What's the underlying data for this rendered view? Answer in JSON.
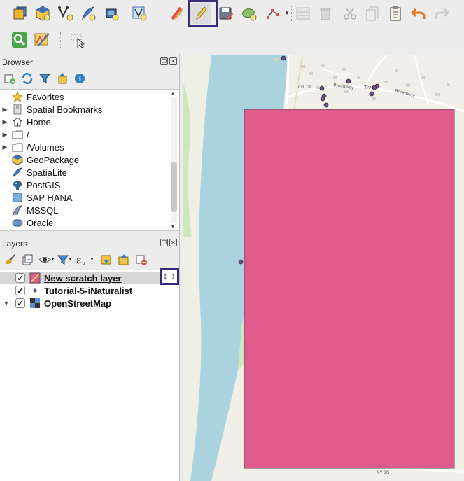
{
  "toolbar": {
    "top_buttons": [
      {
        "name": "open-data-source-manager",
        "icon": "data-source-manager-icon"
      },
      {
        "name": "new-geopackage-layer",
        "icon": "new-geopackage-icon"
      },
      {
        "name": "new-shapefile-layer",
        "icon": "new-shapefile-icon"
      },
      {
        "name": "new-spatialite-layer",
        "icon": "new-spatialite-icon"
      },
      {
        "name": "new-temporary-scratch-layer",
        "icon": "new-scratch-layer-icon"
      },
      {
        "name": "new-virtual-layer",
        "icon": "new-virtual-layer-icon"
      },
      {
        "name": "current-edits",
        "icon": "current-edits-icon"
      },
      {
        "name": "toggle-editing",
        "icon": "pencil-icon",
        "active": true
      },
      {
        "name": "save-layer-edits",
        "icon": "save-edits-icon"
      },
      {
        "name": "add-polygon-feature",
        "icon": "add-polygon-icon"
      },
      {
        "name": "vertex-tool",
        "icon": "vertex-tool-icon"
      },
      {
        "name": "modify-attributes",
        "icon": "modify-attributes-icon"
      },
      {
        "name": "delete-selected",
        "icon": "trash-icon"
      },
      {
        "name": "cut-features",
        "icon": "scissors-icon"
      },
      {
        "name": "copy-features",
        "icon": "copy-icon"
      },
      {
        "name": "paste-features",
        "icon": "paste-icon"
      },
      {
        "name": "undo",
        "icon": "undo-icon"
      },
      {
        "name": "redo",
        "icon": "redo-icon"
      }
    ],
    "second_row": [
      {
        "name": "identify-features",
        "icon": "magnifier-icon"
      },
      {
        "name": "map-tips",
        "icon": "map-tips-icon"
      },
      {
        "name": "select-features",
        "icon": "select-pointer-icon"
      }
    ]
  },
  "browser": {
    "title": "Browser",
    "items": [
      {
        "label": "Favorites",
        "icon": "star-icon",
        "expandable": false
      },
      {
        "label": "Spatial Bookmarks",
        "icon": "bookmark-icon",
        "expandable": true
      },
      {
        "label": "Home",
        "icon": "home-icon",
        "expandable": true
      },
      {
        "label": "/",
        "icon": "folder-icon",
        "expandable": true
      },
      {
        "label": "/Volumes",
        "icon": "folder-icon",
        "expandable": true
      },
      {
        "label": "GeoPackage",
        "icon": "geopackage-icon",
        "expandable": false
      },
      {
        "label": "SpatiaLite",
        "icon": "spatialite-icon",
        "expandable": false
      },
      {
        "label": "PostGIS",
        "icon": "postgis-icon",
        "expandable": false
      },
      {
        "label": "SAP HANA",
        "icon": "sap-hana-icon",
        "expandable": false
      },
      {
        "label": "MSSQL",
        "icon": "mssql-icon",
        "expandable": false
      },
      {
        "label": "Oracle",
        "icon": "oracle-icon",
        "expandable": false
      }
    ]
  },
  "layers": {
    "title": "Layers",
    "items": [
      {
        "label": "New scratch layer",
        "icon": "polygon-layer-icon",
        "checked": true,
        "editing": true,
        "underlined": true
      },
      {
        "label": "Tutorial-5-iNaturalist",
        "icon": "point-layer-icon",
        "checked": true,
        "editing": false,
        "underlined": false
      },
      {
        "label": "OpenStreetMap",
        "icon": "raster-tile-icon",
        "checked": true,
        "editing": false,
        "underlined": false,
        "expandable": true
      }
    ]
  },
  "map": {
    "road_labels": [
      "CR 78",
      "Broadway",
      "Broadway",
      "Tivoli",
      "NY 9G"
    ],
    "colors": {
      "polygon_fill": "#e05a8b",
      "polygon_stroke": "#555555",
      "water": "#aad3df",
      "land": "#f2efe9",
      "park": "#cde7bf",
      "points": "#6d4a8a",
      "highlight": "#3a2a7c"
    }
  }
}
